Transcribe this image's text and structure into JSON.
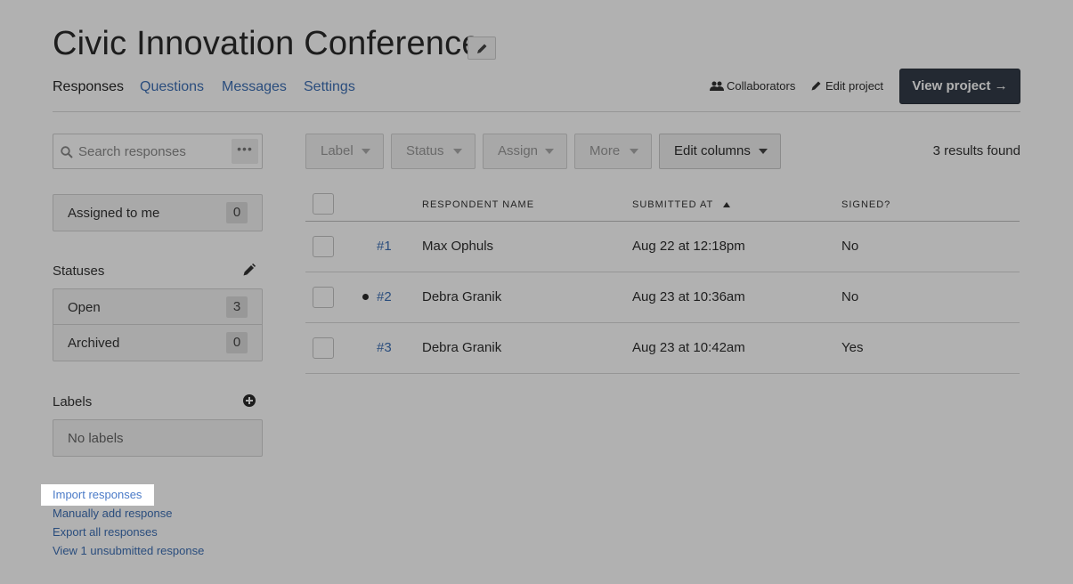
{
  "project": {
    "title": "Civic Innovation Conference"
  },
  "tabs": [
    {
      "label": "Responses",
      "active": true
    },
    {
      "label": "Questions",
      "active": false
    },
    {
      "label": "Messages",
      "active": false
    },
    {
      "label": "Settings",
      "active": false
    }
  ],
  "header_actions": {
    "collaborators": "Collaborators",
    "edit_project": "Edit project",
    "view_project": "View project →"
  },
  "search": {
    "placeholder": "Search responses",
    "more_label": "•••"
  },
  "assigned": {
    "label": "Assigned to me",
    "count": "0"
  },
  "statuses": {
    "heading": "Statuses",
    "items": [
      {
        "label": "Open",
        "count": "3"
      },
      {
        "label": "Archived",
        "count": "0"
      }
    ]
  },
  "labels": {
    "heading": "Labels",
    "empty": "No labels"
  },
  "footer_links": [
    "Import responses",
    "Manually add response",
    "Export all responses",
    "View 1 unsubmitted response"
  ],
  "toolbar": {
    "label": "Label",
    "status": "Status",
    "assign": "Assign",
    "more": "More",
    "edit_columns": "Edit columns",
    "results": "3 results found"
  },
  "table": {
    "columns": [
      "RESPONDENT NAME",
      "SUBMITTED AT",
      "SIGNED?"
    ],
    "rows": [
      {
        "id": "#1",
        "name": "Max Ophuls",
        "submitted": "Aug 22 at 12:18pm",
        "signed": "No",
        "unread": false
      },
      {
        "id": "#2",
        "name": "Debra Granik",
        "submitted": "Aug 23 at 10:36am",
        "signed": "No",
        "unread": true
      },
      {
        "id": "#3",
        "name": "Debra Granik",
        "submitted": "Aug 23 at 10:42am",
        "signed": "Yes",
        "unread": false
      }
    ]
  },
  "colors": {
    "accent": "#3d6fb5",
    "primary_button": "#333c48",
    "overlay": "rgba(0,0,0,0.3)"
  }
}
